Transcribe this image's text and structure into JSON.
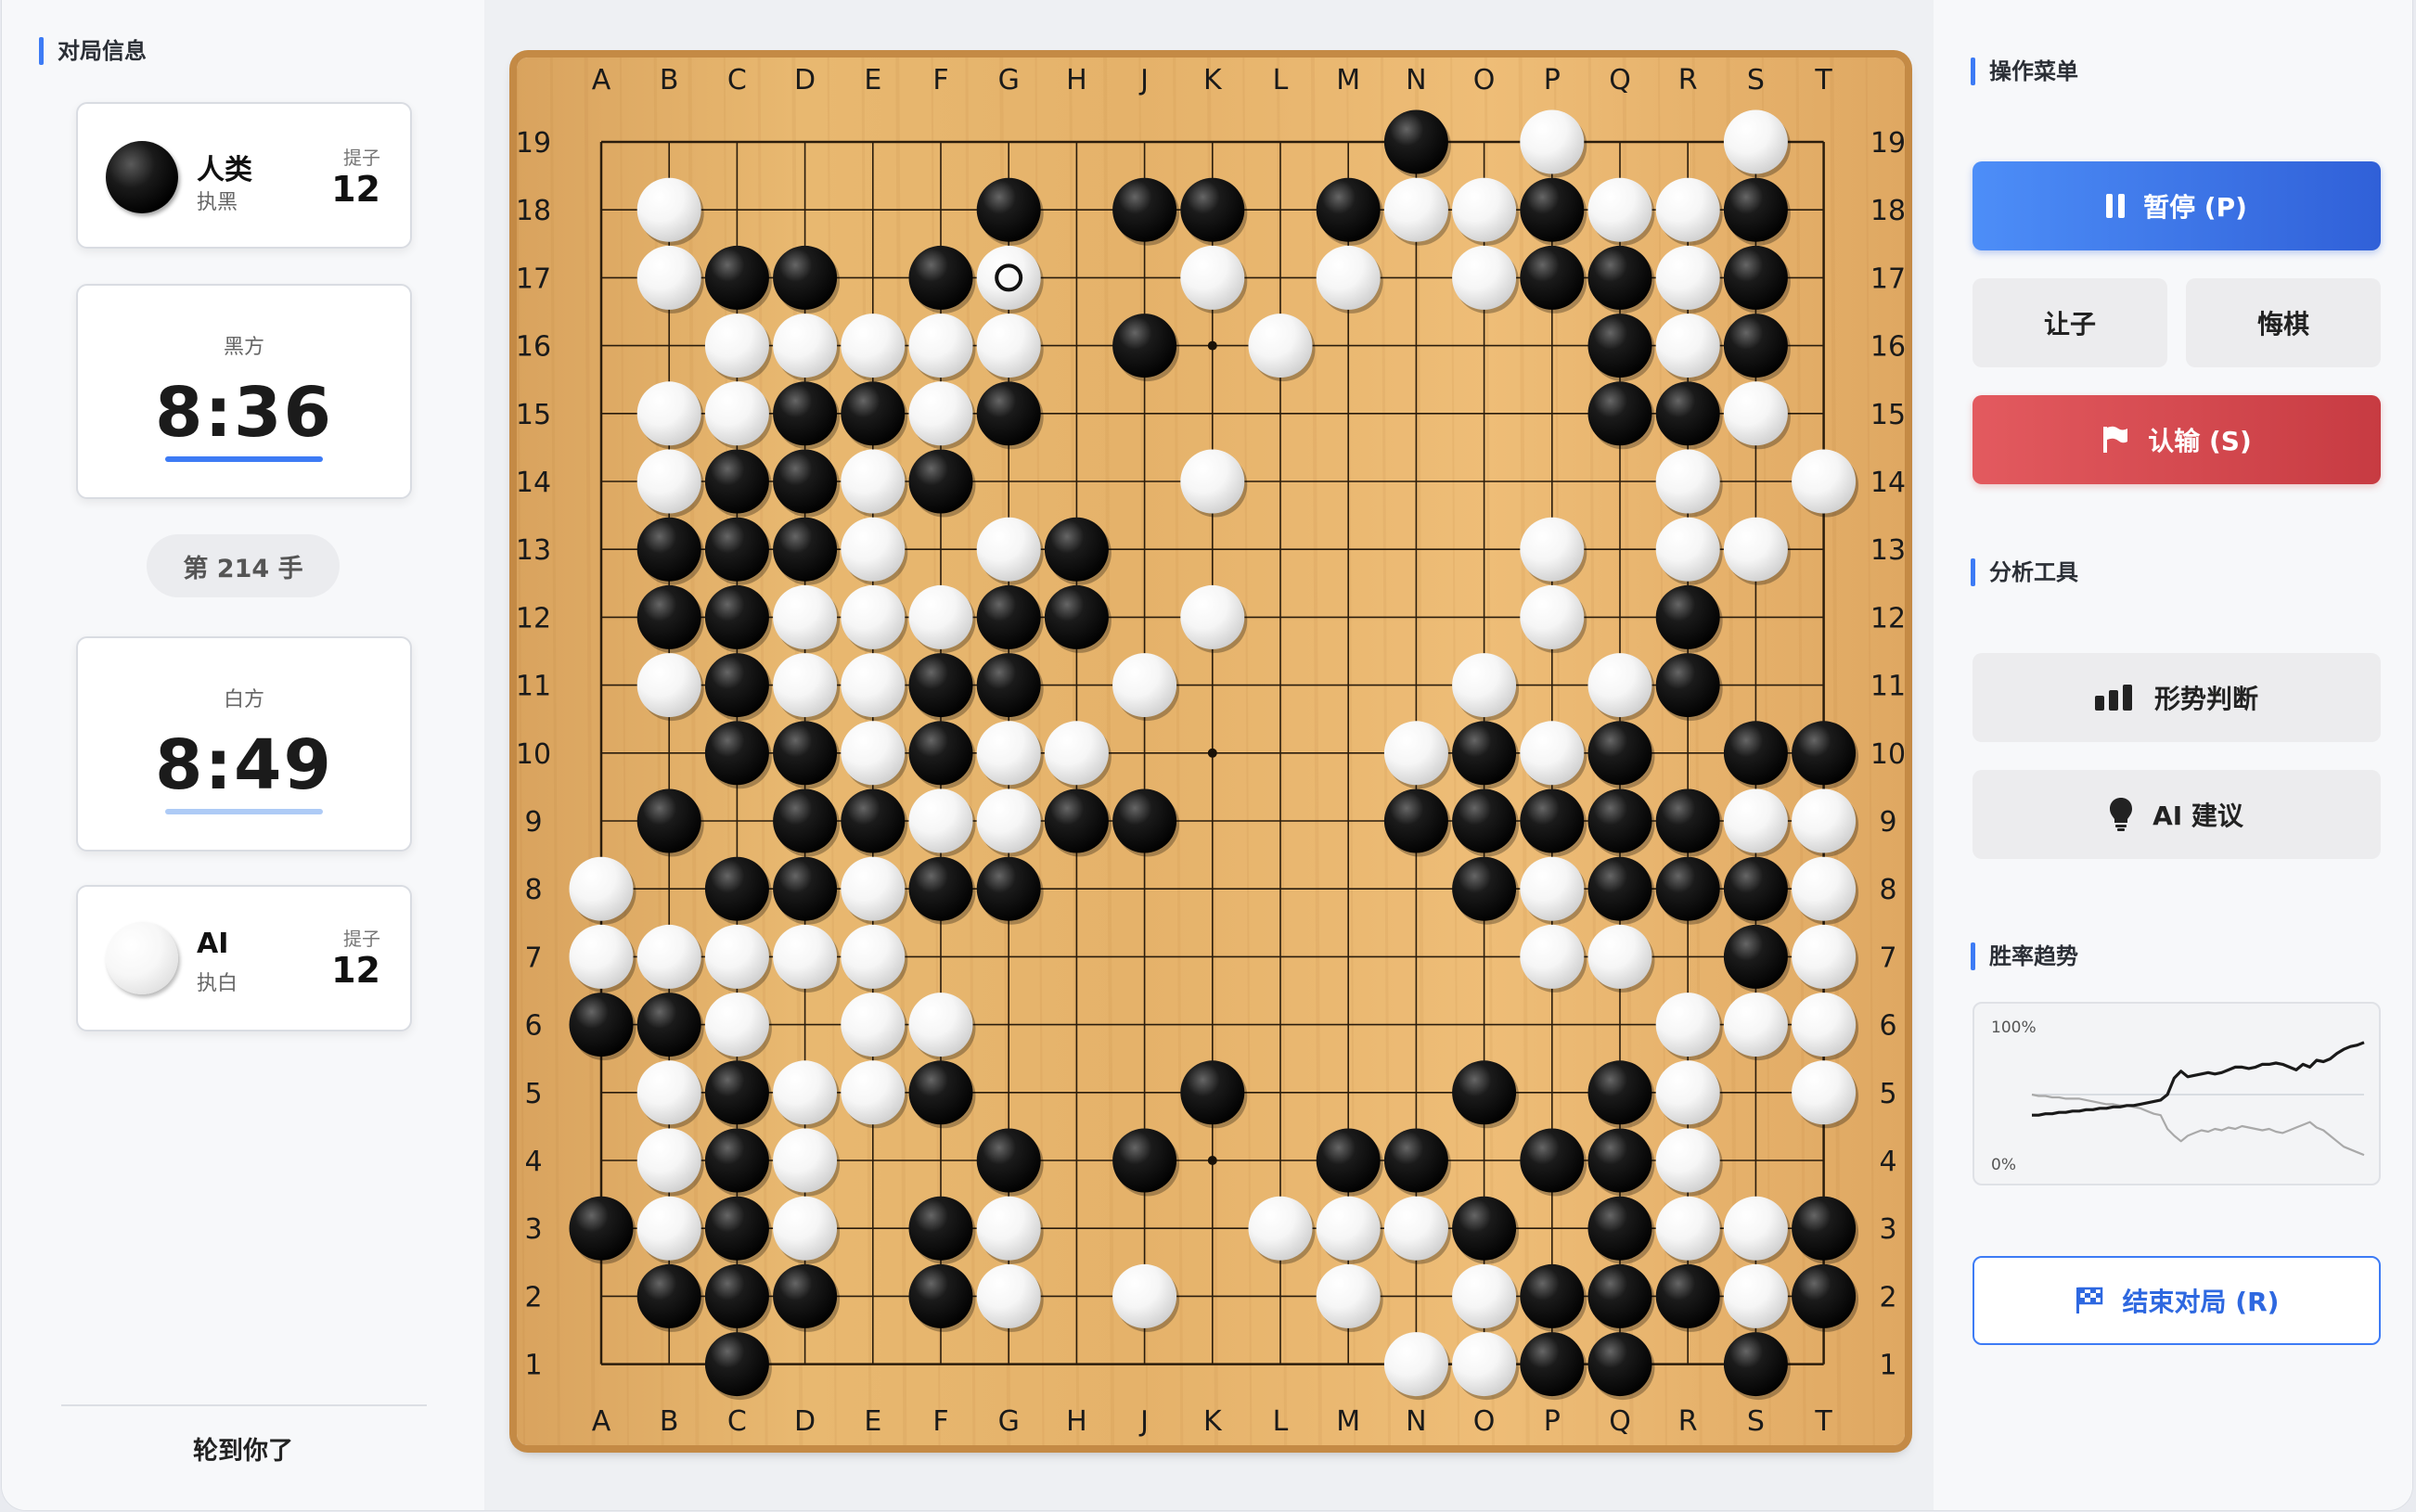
{
  "left_panel": {
    "title": "对局信息",
    "player_black": {
      "name": "人类",
      "role": "执黑",
      "captures_label": "提子",
      "captures": "12"
    },
    "clock_black": {
      "label": "黑方",
      "time": "8:36"
    },
    "move_counter": "第 214 手",
    "clock_white": {
      "label": "白方",
      "time": "8:49"
    },
    "player_white": {
      "name": "AI",
      "role": "执白",
      "captures_label": "提子",
      "captures": "12"
    },
    "status": "轮到你了"
  },
  "board": {
    "columns": [
      "A",
      "B",
      "C",
      "D",
      "E",
      "F",
      "G",
      "H",
      "J",
      "K",
      "L",
      "M",
      "N",
      "O",
      "P",
      "Q",
      "R",
      "S",
      "T"
    ],
    "rows": [
      "19",
      "18",
      "17",
      "16",
      "15",
      "14",
      "13",
      "12",
      "11",
      "10",
      "9",
      "8",
      "7",
      "6",
      "5",
      "4",
      "3",
      "2",
      "1"
    ],
    "star_points": [
      "D16",
      "K16",
      "Q16",
      "D10",
      "K10",
      "Q10",
      "D4",
      "K4",
      "Q4"
    ],
    "last_move": "G17",
    "black_stones": [
      "N19",
      "G18",
      "J18",
      "K18",
      "M18",
      "P18",
      "S18",
      "C17",
      "D17",
      "F17",
      "P17",
      "Q17",
      "S17",
      "J16",
      "Q16",
      "S16",
      "D15",
      "E15",
      "G15",
      "Q15",
      "R15",
      "C14",
      "D14",
      "F14",
      "B13",
      "C13",
      "D13",
      "H13",
      "B12",
      "C12",
      "G12",
      "H12",
      "R12",
      "C11",
      "F11",
      "G11",
      "R11",
      "C10",
      "D10",
      "F10",
      "O10",
      "Q10",
      "S10",
      "T10",
      "B9",
      "D9",
      "E9",
      "H9",
      "J9",
      "N9",
      "O9",
      "P9",
      "Q9",
      "R9",
      "C8",
      "D8",
      "F8",
      "G8",
      "O8",
      "Q8",
      "R8",
      "S8",
      "S7",
      "A6",
      "B6",
      "C5",
      "F5",
      "K5",
      "O5",
      "Q5",
      "C4",
      "G4",
      "J4",
      "M4",
      "N4",
      "P4",
      "Q4",
      "A3",
      "C3",
      "F3",
      "O3",
      "Q3",
      "T3",
      "B2",
      "C2",
      "D2",
      "F2",
      "P2",
      "Q2",
      "R2",
      "T2",
      "C1",
      "P1",
      "Q1",
      "S1"
    ],
    "white_stones": [
      "P19",
      "S19",
      "B18",
      "N18",
      "O18",
      "Q18",
      "R18",
      "B17",
      "G17",
      "K17",
      "M17",
      "O17",
      "R17",
      "C16",
      "D16",
      "E16",
      "F16",
      "G16",
      "L16",
      "R16",
      "B15",
      "C15",
      "F15",
      "S15",
      "B14",
      "E14",
      "K14",
      "R14",
      "T14",
      "E13",
      "G13",
      "P13",
      "R13",
      "S13",
      "D12",
      "E12",
      "F12",
      "K12",
      "P12",
      "B11",
      "D11",
      "E11",
      "J11",
      "O11",
      "Q11",
      "E10",
      "G10",
      "H10",
      "N10",
      "P10",
      "F9",
      "G9",
      "S9",
      "T9",
      "A8",
      "E8",
      "P8",
      "T8",
      "A7",
      "B7",
      "C7",
      "D7",
      "E7",
      "P7",
      "Q7",
      "T7",
      "C6",
      "E6",
      "F6",
      "R6",
      "S6",
      "T6",
      "B5",
      "D5",
      "E5",
      "R5",
      "T5",
      "B4",
      "D4",
      "R4",
      "B3",
      "D3",
      "G3",
      "L3",
      "M3",
      "N3",
      "R3",
      "S3",
      "G2",
      "J2",
      "M2",
      "O2",
      "S2",
      "N1",
      "O1"
    ]
  },
  "right_panel": {
    "menu_title": "操作菜单",
    "pause_label": "暂停 (P)",
    "handicap_label": "让子",
    "undo_label": "悔棋",
    "resign_label": "认输 (S)",
    "analysis_title": "分析工具",
    "evaluate_label": "形势判断",
    "ai_hint_label": "AI 建议",
    "winrate_title": "胜率趋势",
    "end_game_label": "结束对局 (R)"
  },
  "chart_data": {
    "type": "line",
    "ylim": [
      0,
      100
    ],
    "y_tick_labels": [
      "100%",
      "0%"
    ],
    "series": [
      {
        "values": [
          35,
          35,
          36,
          36,
          37,
          37,
          38,
          38,
          39,
          39,
          40,
          40,
          41,
          41,
          42,
          42,
          43,
          44,
          45,
          46,
          50,
          62,
          67,
          63,
          64,
          65,
          66,
          65,
          66,
          68,
          70,
          70,
          69,
          70,
          72,
          72,
          73,
          72,
          70,
          68,
          72,
          70,
          75,
          74,
          76,
          80,
          83,
          85,
          86,
          88
        ]
      },
      {
        "values": [
          50,
          49,
          49,
          48,
          48,
          47,
          47,
          47,
          46,
          45,
          44,
          43,
          43,
          42,
          42,
          41,
          40,
          38,
          36,
          35,
          25,
          20,
          16,
          20,
          22,
          24,
          23,
          25,
          24,
          26,
          25,
          27,
          26,
          25,
          24,
          25,
          23,
          22,
          24,
          26,
          28,
          30,
          26,
          24,
          20,
          16,
          12,
          10,
          8,
          6
        ]
      }
    ]
  },
  "colors": {
    "accent": "#3d7bf5",
    "danger": "#d9464d",
    "board": "#e8b870"
  }
}
